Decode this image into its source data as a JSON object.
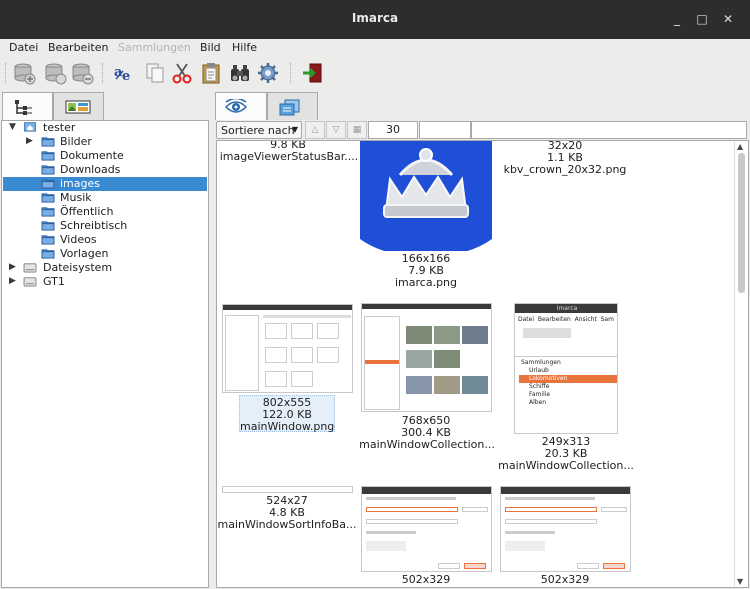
{
  "window": {
    "title": "Imarca",
    "controls": [
      "_",
      "□",
      "✕"
    ]
  },
  "menu": [
    {
      "label": "Datei",
      "disabled": false
    },
    {
      "label": "Bearbeiten",
      "disabled": false
    },
    {
      "label": "Sammlungen",
      "disabled": true
    },
    {
      "label": "Bild",
      "disabled": false
    },
    {
      "label": "Hilfe",
      "disabled": false
    }
  ],
  "toolbar": {
    "buttons": [
      "add-collection-icon",
      "collection-db-icon",
      "remove-collection-icon",
      "spellcheck-icon",
      "copy-icon",
      "cut-icon",
      "paste-icon",
      "find-icon",
      "settings-icon",
      "exit-icon"
    ]
  },
  "left_tabs": [
    "folder-tree-icon",
    "collections-icon"
  ],
  "tree": [
    {
      "label": "tester",
      "level": 0,
      "expanded": true,
      "type": "home"
    },
    {
      "label": "Bilder",
      "level": 1,
      "expandable": true,
      "type": "folder"
    },
    {
      "label": "Dokumente",
      "level": 1,
      "type": "folder"
    },
    {
      "label": "Downloads",
      "level": 1,
      "type": "folder"
    },
    {
      "label": "images",
      "level": 1,
      "type": "folder",
      "selected": true
    },
    {
      "label": "Musik",
      "level": 1,
      "type": "folder"
    },
    {
      "label": "Öffentlich",
      "level": 1,
      "type": "folder"
    },
    {
      "label": "Schreibtisch",
      "level": 1,
      "type": "folder"
    },
    {
      "label": "Videos",
      "level": 1,
      "type": "folder"
    },
    {
      "label": "Vorlagen",
      "level": 1,
      "type": "folder"
    },
    {
      "label": "Dateisystem",
      "level": 0,
      "expandable": true,
      "type": "drive"
    },
    {
      "label": "GT1",
      "level": 0,
      "expandable": true,
      "type": "drive"
    }
  ],
  "right_tabs": [
    "view-icon",
    "export-icon"
  ],
  "sortbar": {
    "sort_label": "Sortiere nach",
    "count": "30"
  },
  "thumbnails": [
    {
      "dims": "",
      "size": "9.8 KB",
      "name": "imageViewerStatusBar...."
    },
    {
      "dims": "166x166",
      "size": "7.9 KB",
      "name": "imarca.png"
    },
    {
      "dims": "32x20",
      "size": "1.1 KB",
      "name": "kbv_crown_20x32.png"
    },
    {
      "dims": "802x555",
      "size": "122.0 KB",
      "name": "mainWindow.png",
      "selected": true
    },
    {
      "dims": "768x650",
      "size": "300.4 KB",
      "name": "mainWindowCollection..."
    },
    {
      "dims": "249x313",
      "size": "20.3 KB",
      "name": "mainWindowCollection..."
    },
    {
      "dims": "524x27",
      "size": "4.8 KB",
      "name": "mainWindowSortInfoBa..."
    },
    {
      "dims": "502x329",
      "size": "",
      "name": ""
    },
    {
      "dims": "502x329",
      "size": "",
      "name": ""
    }
  ],
  "mini_collections": {
    "title": "Imarca",
    "menu": [
      "Datei",
      "Bearbeiten",
      "Ansicht",
      "Sam"
    ],
    "items": [
      "Sammlungen",
      "Urlaub",
      "Lokomotiven",
      "Schiffe",
      "Familie",
      "Alben"
    ]
  },
  "colors": {
    "accent": "#3a8ad2",
    "titlebar": "#2d2d2d",
    "crown_bg": "#1f4fd6",
    "folder": "#4a90d9"
  }
}
